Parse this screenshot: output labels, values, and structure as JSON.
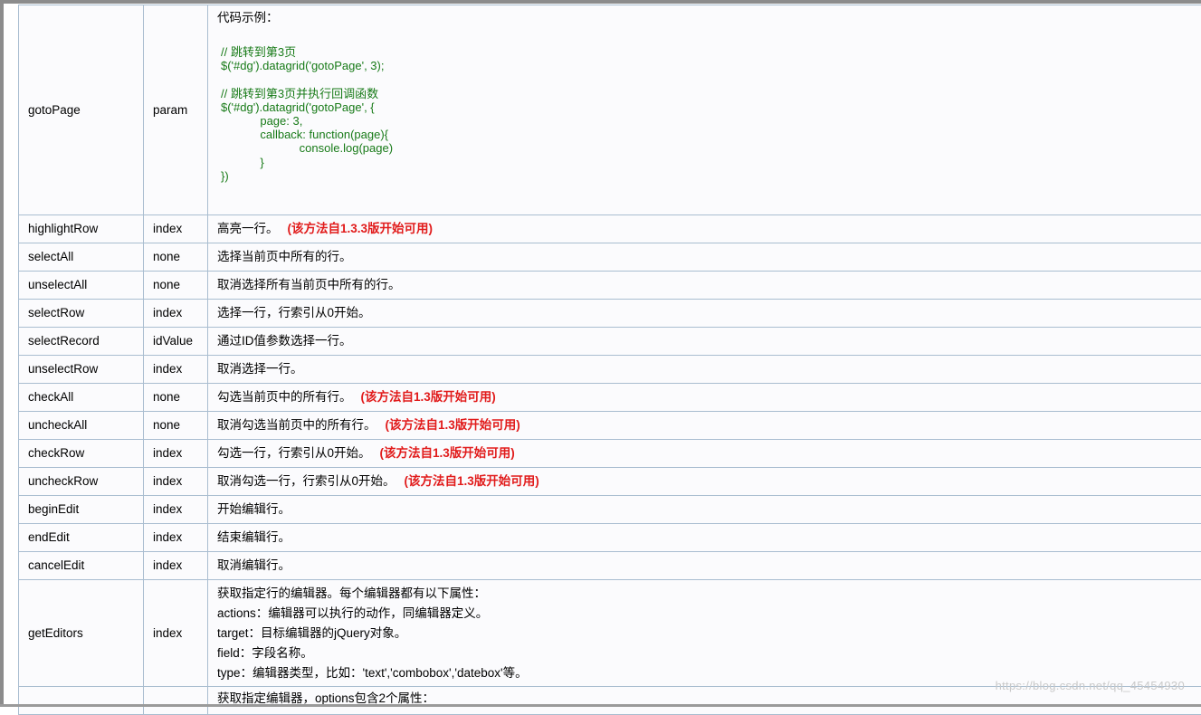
{
  "rows": [
    {
      "name": "gotoPage",
      "param": "param",
      "desc": "代码示例：",
      "code": "// 跳转到第3页\n$('#dg').datagrid('gotoPage', 3);\n\n// 跳转到第3页并执行回调函数\n$('#dg').datagrid('gotoPage', {\n            page: 3,\n            callback: function(page){\n                        console.log(page)\n            }\n})"
    },
    {
      "name": "highlightRow",
      "param": "index",
      "desc": "高亮一行。",
      "note": "(该方法自1.3.3版开始可用)"
    },
    {
      "name": "selectAll",
      "param": "none",
      "desc": "选择当前页中所有的行。"
    },
    {
      "name": "unselectAll",
      "param": "none",
      "desc": "取消选择所有当前页中所有的行。"
    },
    {
      "name": "selectRow",
      "param": "index",
      "desc": "选择一行，行索引从0开始。"
    },
    {
      "name": "selectRecord",
      "param": "idValue",
      "desc": "通过ID值参数选择一行。"
    },
    {
      "name": "unselectRow",
      "param": "index",
      "desc": "取消选择一行。"
    },
    {
      "name": "checkAll",
      "param": "none",
      "desc": "勾选当前页中的所有行。",
      "note": "(该方法自1.3版开始可用)"
    },
    {
      "name": "uncheckAll",
      "param": "none",
      "desc": "取消勾选当前页中的所有行。",
      "note": "(该方法自1.3版开始可用)"
    },
    {
      "name": "checkRow",
      "param": "index",
      "desc": "勾选一行，行索引从0开始。",
      "note": "(该方法自1.3版开始可用)"
    },
    {
      "name": "uncheckRow",
      "param": "index",
      "desc": "取消勾选一行，行索引从0开始。",
      "note": "(该方法自1.3版开始可用)"
    },
    {
      "name": "beginEdit",
      "param": "index",
      "desc": "开始编辑行。"
    },
    {
      "name": "endEdit",
      "param": "index",
      "desc": "结束编辑行。"
    },
    {
      "name": "cancelEdit",
      "param": "index",
      "desc": "取消编辑行。"
    },
    {
      "name": "getEditors",
      "param": "index",
      "lines": [
        "获取指定行的编辑器。每个编辑器都有以下属性：",
        "actions：编辑器可以执行的动作，同编辑器定义。",
        "target：目标编辑器的jQuery对象。",
        "field：字段名称。",
        "type：编辑器类型，比如：'text','combobox','datebox'等。"
      ]
    },
    {
      "name": "",
      "param": "",
      "desc": "获取指定编辑器，options包含2个属性："
    }
  ],
  "watermark": "https://blog.csdn.net/qq_45454930"
}
